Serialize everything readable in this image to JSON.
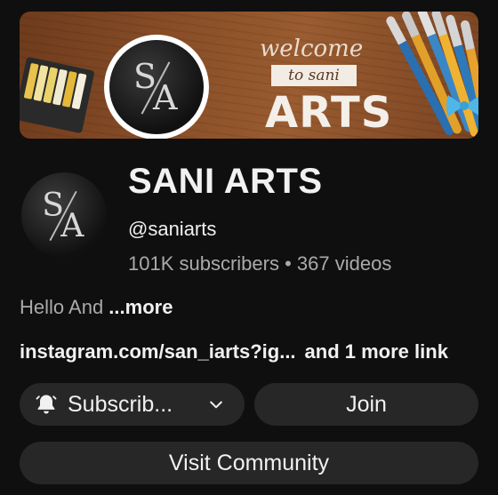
{
  "banner": {
    "welcome_text": "welcome",
    "to_text": "to sani",
    "brand_text": "ARTS",
    "monogram": "SA"
  },
  "channel": {
    "name": "SANI ARTS",
    "handle": "@saniarts",
    "subscribers": "101K subscribers",
    "separator": " • ",
    "videos": "367 videos",
    "description": "Hello And ",
    "more_label": "...more",
    "link_text": "instagram.com/san_iarts?ig...",
    "extra_links": "and 1 more link"
  },
  "actions": {
    "subscribe_label": "Subscrib...",
    "join_label": "Join",
    "community_label": "Visit Community"
  },
  "colors": {
    "background": "#0f0f0f",
    "button_bg": "#272727",
    "text_primary": "#f1f1f1",
    "text_secondary": "#aaaaaa"
  },
  "icons": [
    "bell-icon",
    "chevron-down-icon"
  ]
}
